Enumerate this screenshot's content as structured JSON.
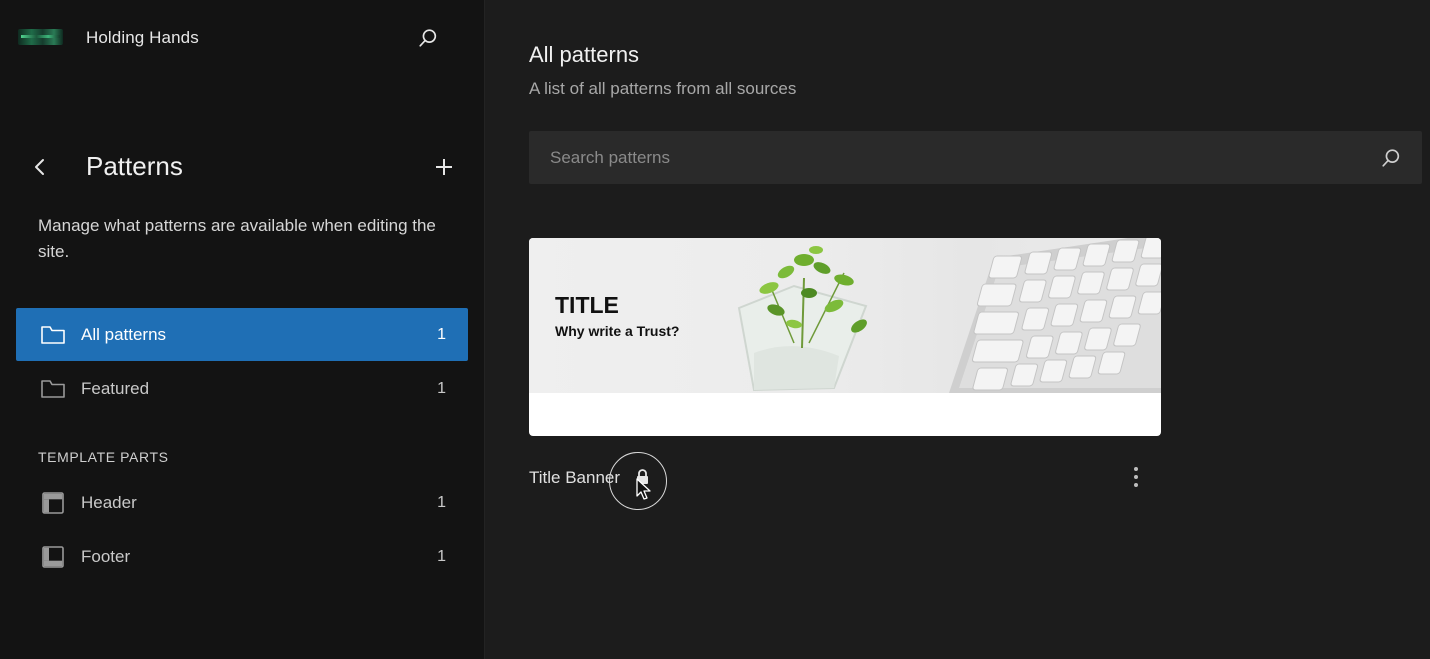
{
  "site": {
    "title": "Holding Hands",
    "logo_icon": "site-logo-icon",
    "search_icon": "search-icon"
  },
  "sidebar": {
    "back_icon": "chevron-left-icon",
    "title": "Patterns",
    "add_icon": "plus-icon",
    "description": "Manage what patterns are available when editing the site.",
    "items": [
      {
        "label": "All patterns",
        "count": "1",
        "icon": "folder-icon",
        "active": true
      },
      {
        "label": "Featured",
        "count": "1",
        "icon": "folder-icon",
        "active": false
      }
    ],
    "template_parts_heading": "TEMPLATE PARTS",
    "template_parts": [
      {
        "label": "Header",
        "count": "1",
        "icon": "header-layout-icon"
      },
      {
        "label": "Footer",
        "count": "1",
        "icon": "footer-layout-icon"
      }
    ]
  },
  "main": {
    "title": "All patterns",
    "subtitle": "A list of all patterns from all sources",
    "search": {
      "placeholder": "Search patterns",
      "value": ""
    },
    "patterns": [
      {
        "name": "Title Banner",
        "preview_title": "TITLE",
        "preview_subtitle": "Why write a Trust?",
        "locked": true,
        "lock_icon": "lock-icon",
        "actions_icon": "more-vertical-icon"
      }
    ]
  },
  "colors": {
    "accent": "#1f6fb5",
    "sidebar_bg": "#131313",
    "main_bg": "#1c1c1c",
    "input_bg": "#2a2a2a"
  }
}
